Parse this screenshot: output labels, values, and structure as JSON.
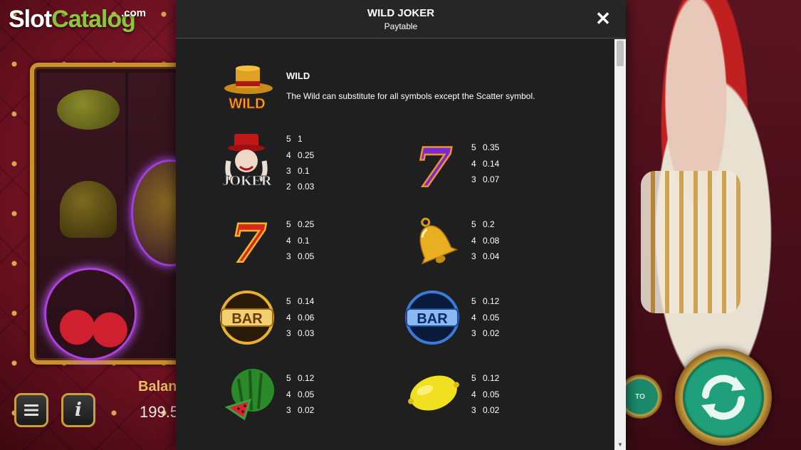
{
  "branding": {
    "logo_slot": "Slot",
    "logo_catalog": "Catalog",
    "logo_com": ".com"
  },
  "game": {
    "balance_label": "Balan",
    "balance_value": "199.5",
    "menu_icon": "hamburger-icon",
    "info_icon": "info-icon",
    "info_glyph": "i",
    "auto_label": "TO",
    "spin_icon": "spin-arrows-icon"
  },
  "modal": {
    "title": "WILD JOKER",
    "subtitle": "Paytable",
    "close_glyph": "✕",
    "wild": {
      "icon": "wild-hat-icon",
      "icon_text": "WILD",
      "heading": "WILD",
      "description": "The Wild can substitute for all symbols except the Scatter symbol."
    },
    "symbols": [
      {
        "name": "joker",
        "icon": "joker-icon",
        "icon_text": "JOKER",
        "pays": [
          {
            "count": "5",
            "value": "1"
          },
          {
            "count": "4",
            "value": "0.25"
          },
          {
            "count": "3",
            "value": "0.1"
          },
          {
            "count": "2",
            "value": "0.03"
          }
        ]
      },
      {
        "name": "purple-seven",
        "icon": "purple-seven-icon",
        "icon_text": "7",
        "pays": [
          {
            "count": "5",
            "value": "0.35"
          },
          {
            "count": "4",
            "value": "0.14"
          },
          {
            "count": "3",
            "value": "0.07"
          }
        ]
      },
      {
        "name": "red-seven",
        "icon": "red-seven-icon",
        "icon_text": "7",
        "pays": [
          {
            "count": "5",
            "value": "0.25"
          },
          {
            "count": "4",
            "value": "0.1"
          },
          {
            "count": "3",
            "value": "0.05"
          }
        ]
      },
      {
        "name": "bell",
        "icon": "bell-icon",
        "pays": [
          {
            "count": "5",
            "value": "0.2"
          },
          {
            "count": "4",
            "value": "0.08"
          },
          {
            "count": "3",
            "value": "0.04"
          }
        ]
      },
      {
        "name": "gold-bar",
        "icon": "gold-bar-icon",
        "icon_text": "BAR",
        "pays": [
          {
            "count": "5",
            "value": "0.14"
          },
          {
            "count": "4",
            "value": "0.06"
          },
          {
            "count": "3",
            "value": "0.03"
          }
        ]
      },
      {
        "name": "blue-bar",
        "icon": "blue-bar-icon",
        "icon_text": "BAR",
        "pays": [
          {
            "count": "5",
            "value": "0.12"
          },
          {
            "count": "4",
            "value": "0.05"
          },
          {
            "count": "3",
            "value": "0.02"
          }
        ]
      },
      {
        "name": "watermelon",
        "icon": "watermelon-icon",
        "pays": [
          {
            "count": "5",
            "value": "0.12"
          },
          {
            "count": "4",
            "value": "0.05"
          },
          {
            "count": "3",
            "value": "0.02"
          }
        ]
      },
      {
        "name": "lemon",
        "icon": "lemon-icon",
        "pays": [
          {
            "count": "5",
            "value": "0.12"
          },
          {
            "count": "4",
            "value": "0.05"
          },
          {
            "count": "3",
            "value": "0.02"
          }
        ]
      }
    ]
  },
  "colors": {
    "modal_bg": "#262626",
    "modal_body_bg": "#1f1f1f",
    "text": "#ffffff",
    "logo_green": "#8cc63f",
    "frame_gold": "#c9922c",
    "spin_green": "#1fa07a"
  }
}
